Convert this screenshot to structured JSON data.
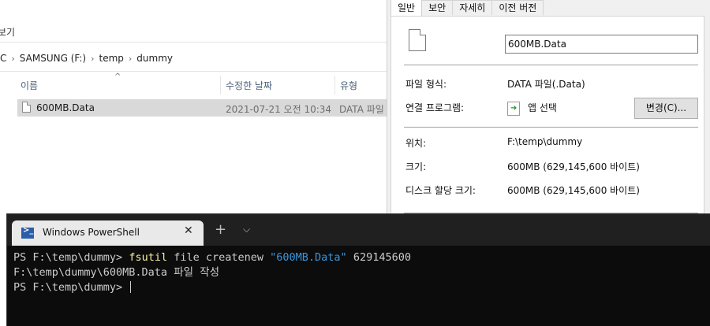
{
  "explorer": {
    "ribbon_partial": "보기",
    "breadcrumb": [
      "C",
      "SAMSUNG (F:)",
      "temp",
      "dummy"
    ],
    "columns": {
      "name": "이름",
      "date": "수정한 날짜",
      "type": "유형"
    },
    "sort_indicator": "^",
    "files": [
      {
        "name": "600MB.Data",
        "date": "2021-07-21 오전 10:34",
        "type": "DATA 파일"
      }
    ]
  },
  "properties": {
    "tabs": [
      "일반",
      "보안",
      "자세히",
      "이전 버전"
    ],
    "active_tab": "일반",
    "file_name": "600MB.Data",
    "file_type_label": "파일 형식:",
    "file_type_value": "DATA 파일(.Data)",
    "opens_with_label": "연결 프로그램:",
    "opens_with_value": "앱 선택",
    "change_button": "변경(C)...",
    "location_label": "위치:",
    "location_value": "F:\\temp\\dummy",
    "size_label": "크기:",
    "size_value": "600MB (629,145,600 바이트)",
    "size_on_disk_label": "디스크 할당 크기:",
    "size_on_disk_value": "600MB (629,145,600 바이트)"
  },
  "terminal": {
    "tab_title": "Windows PowerShell",
    "close_glyph": "✕",
    "new_tab_glyph": "+",
    "dropdown_glyph": "⌵",
    "lines": {
      "l1_prompt": "PS F:\\temp\\dummy> ",
      "l1_cmd": "fsutil",
      "l1_args": " file createnew ",
      "l1_str": "\"600MB.Data\"",
      "l1_num": " 629145600",
      "l2": "F:\\temp\\dummy\\600MB.Data 파일 작성",
      "l3_prompt": "PS F:\\temp\\dummy> "
    }
  },
  "icons": {
    "file": "file-icon",
    "app": "app-choose-icon",
    "powershell": "powershell-icon"
  }
}
